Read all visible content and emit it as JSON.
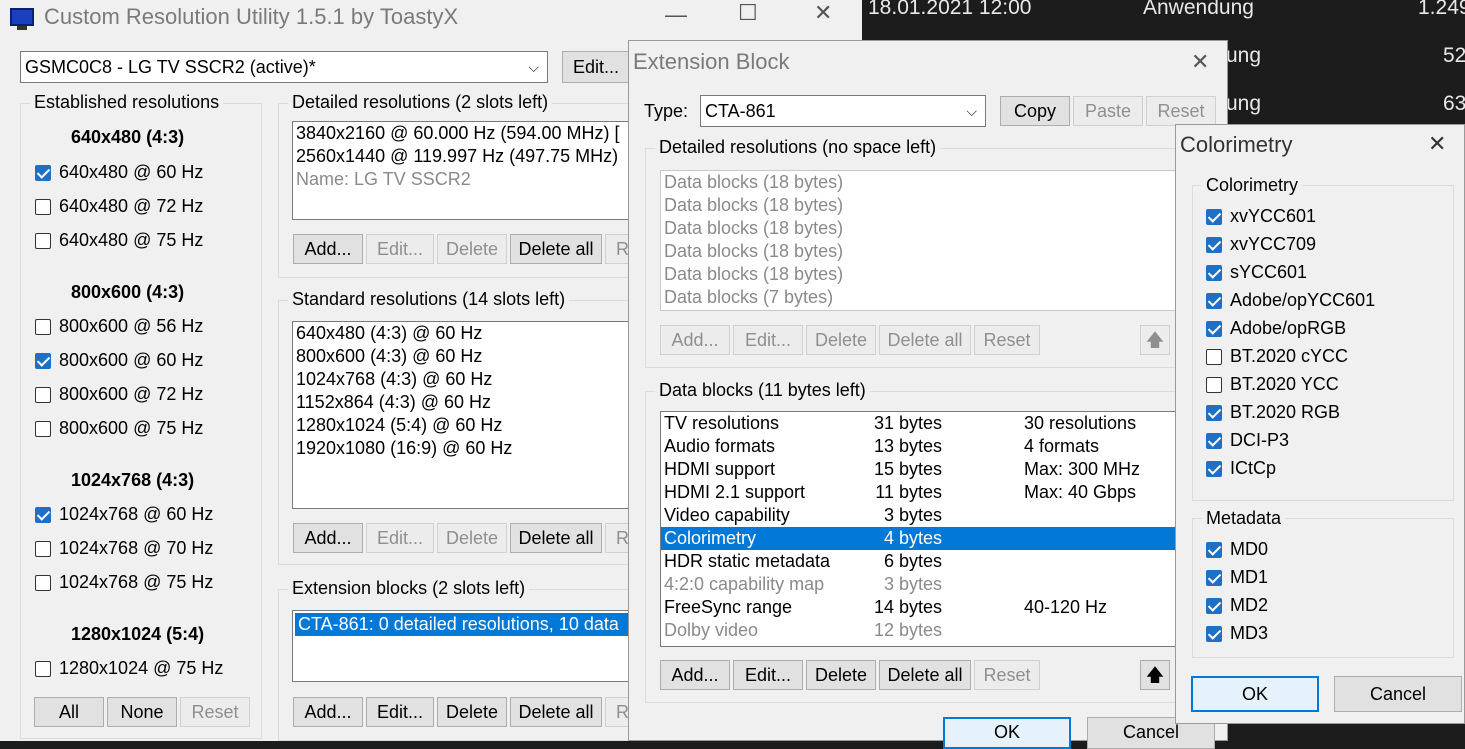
{
  "background_app": {
    "rows": [
      {
        "date": "18.01.2021 12:00",
        "type": "Anwendung",
        "size": "1.249"
      },
      {
        "type_partial": "ung",
        "size": "52"
      },
      {
        "type_partial": "ung",
        "size": "63"
      }
    ]
  },
  "main": {
    "title": "Custom Resolution Utility 1.5.1 by ToastyX",
    "monitor_select": "GSMC0C8 - LG TV SSCR2 (active)*",
    "edit_label": "Edit...",
    "established": {
      "group_label": "Established resolutions",
      "sections": [
        {
          "header": "640x480 (4:3)",
          "items": [
            {
              "label": "640x480 @ 60 Hz",
              "checked": true
            },
            {
              "label": "640x480 @ 72 Hz",
              "checked": false
            },
            {
              "label": "640x480 @ 75 Hz",
              "checked": false
            }
          ]
        },
        {
          "header": "800x600 (4:3)",
          "items": [
            {
              "label": "800x600 @ 56 Hz",
              "checked": false
            },
            {
              "label": "800x600 @ 60 Hz",
              "checked": true
            },
            {
              "label": "800x600 @ 72 Hz",
              "checked": false
            },
            {
              "label": "800x600 @ 75 Hz",
              "checked": false
            }
          ]
        },
        {
          "header": "1024x768 (4:3)",
          "items": [
            {
              "label": "1024x768 @ 60 Hz",
              "checked": true
            },
            {
              "label": "1024x768 @ 70 Hz",
              "checked": false
            },
            {
              "label": "1024x768 @ 75 Hz",
              "checked": false
            }
          ]
        },
        {
          "header": "1280x1024 (5:4)",
          "items": [
            {
              "label": "1280x1024 @ 75 Hz",
              "checked": false
            }
          ]
        }
      ],
      "all_label": "All",
      "none_label": "None",
      "reset_label": "Reset"
    },
    "detailed": {
      "group_label": "Detailed resolutions (2 slots left)",
      "rows": [
        "3840x2160 @ 60.000 Hz (594.00 MHz) [",
        "2560x1440 @ 119.997 Hz (497.75 MHz)",
        "Name: LG TV SSCR2"
      ],
      "add": "Add...",
      "edit": "Edit...",
      "delete": "Delete",
      "delete_all": "Delete all",
      "r": "R"
    },
    "standard": {
      "group_label": "Standard resolutions (14 slots left)",
      "rows": [
        "640x480 (4:3) @ 60 Hz",
        "800x600 (4:3) @ 60 Hz",
        "1024x768 (4:3) @ 60 Hz",
        "1152x864 (4:3) @ 60 Hz",
        "1280x1024 (5:4) @ 60 Hz",
        "1920x1080 (16:9) @ 60 Hz"
      ],
      "add": "Add...",
      "edit": "Edit...",
      "delete": "Delete",
      "delete_all": "Delete all",
      "r": "R"
    },
    "extension": {
      "group_label": "Extension blocks (2 slots left)",
      "rows": [
        "CTA-861: 0 detailed resolutions, 10 data"
      ],
      "add": "Add...",
      "edit": "Edit...",
      "delete": "Delete",
      "delete_all": "Delete all",
      "r": "R"
    }
  },
  "ext_block": {
    "title": "Extension Block",
    "type_label": "Type:",
    "type_value": "CTA-861",
    "copy": "Copy",
    "paste": "Paste",
    "reset": "Reset",
    "detailed_group": "Detailed resolutions (no space left)",
    "detailed_rows": [
      "Data blocks (18 bytes)",
      "Data blocks (18 bytes)",
      "Data blocks (18 bytes)",
      "Data blocks (18 bytes)",
      "Data blocks (18 bytes)",
      "Data blocks (7 bytes)"
    ],
    "data_group": "Data blocks (11 bytes left)",
    "data_rows": [
      {
        "name": "TV resolutions",
        "bytes": "31 bytes",
        "info": "30 resolutions",
        "gray": false,
        "selected": false
      },
      {
        "name": "Audio formats",
        "bytes": "13 bytes",
        "info": "4 formats",
        "gray": false,
        "selected": false
      },
      {
        "name": "HDMI support",
        "bytes": "15 bytes",
        "info": "Max: 300 MHz",
        "gray": false,
        "selected": false
      },
      {
        "name": "HDMI 2.1 support",
        "bytes": "11 bytes",
        "info": "Max: 40 Gbps",
        "gray": false,
        "selected": false
      },
      {
        "name": "Video capability",
        "bytes": "3 bytes",
        "info": "",
        "gray": false,
        "selected": false
      },
      {
        "name": "Colorimetry",
        "bytes": "4 bytes",
        "info": "",
        "gray": false,
        "selected": true
      },
      {
        "name": "HDR static metadata",
        "bytes": "6 bytes",
        "info": "",
        "gray": false,
        "selected": false
      },
      {
        "name": "4:2:0 capability map",
        "bytes": "3 bytes",
        "info": "",
        "gray": true,
        "selected": false
      },
      {
        "name": "FreeSync range",
        "bytes": "14 bytes",
        "info": "40-120 Hz",
        "gray": false,
        "selected": false
      },
      {
        "name": "Dolby video",
        "bytes": "12 bytes",
        "info": "",
        "gray": true,
        "selected": false
      }
    ],
    "add": "Add...",
    "edit": "Edit...",
    "delete": "Delete",
    "delete_all": "Delete all",
    "reset_btn": "Reset",
    "ok": "OK",
    "cancel": "Cancel"
  },
  "colorimetry": {
    "title": "Colorimetry",
    "group_label": "Colorimetry",
    "items": [
      {
        "label": "xvYCC601",
        "checked": true
      },
      {
        "label": "xvYCC709",
        "checked": true
      },
      {
        "label": "sYCC601",
        "checked": true
      },
      {
        "label": "Adobe/opYCC601",
        "checked": true
      },
      {
        "label": "Adobe/opRGB",
        "checked": true
      },
      {
        "label": "BT.2020 cYCC",
        "checked": false
      },
      {
        "label": "BT.2020 YCC",
        "checked": false
      },
      {
        "label": "BT.2020 RGB",
        "checked": true
      },
      {
        "label": "DCI-P3",
        "checked": true
      },
      {
        "label": "ICtCp",
        "checked": true
      }
    ],
    "metadata_label": "Metadata",
    "metadata": [
      {
        "label": "MD0",
        "checked": true
      },
      {
        "label": "MD1",
        "checked": true
      },
      {
        "label": "MD2",
        "checked": true
      },
      {
        "label": "MD3",
        "checked": true
      }
    ],
    "ok": "OK",
    "cancel": "Cancel"
  },
  "colors": {
    "accent": "#0078d7",
    "checkbox": "#1f6fc5",
    "dark_bg": "#1c1c1c"
  }
}
